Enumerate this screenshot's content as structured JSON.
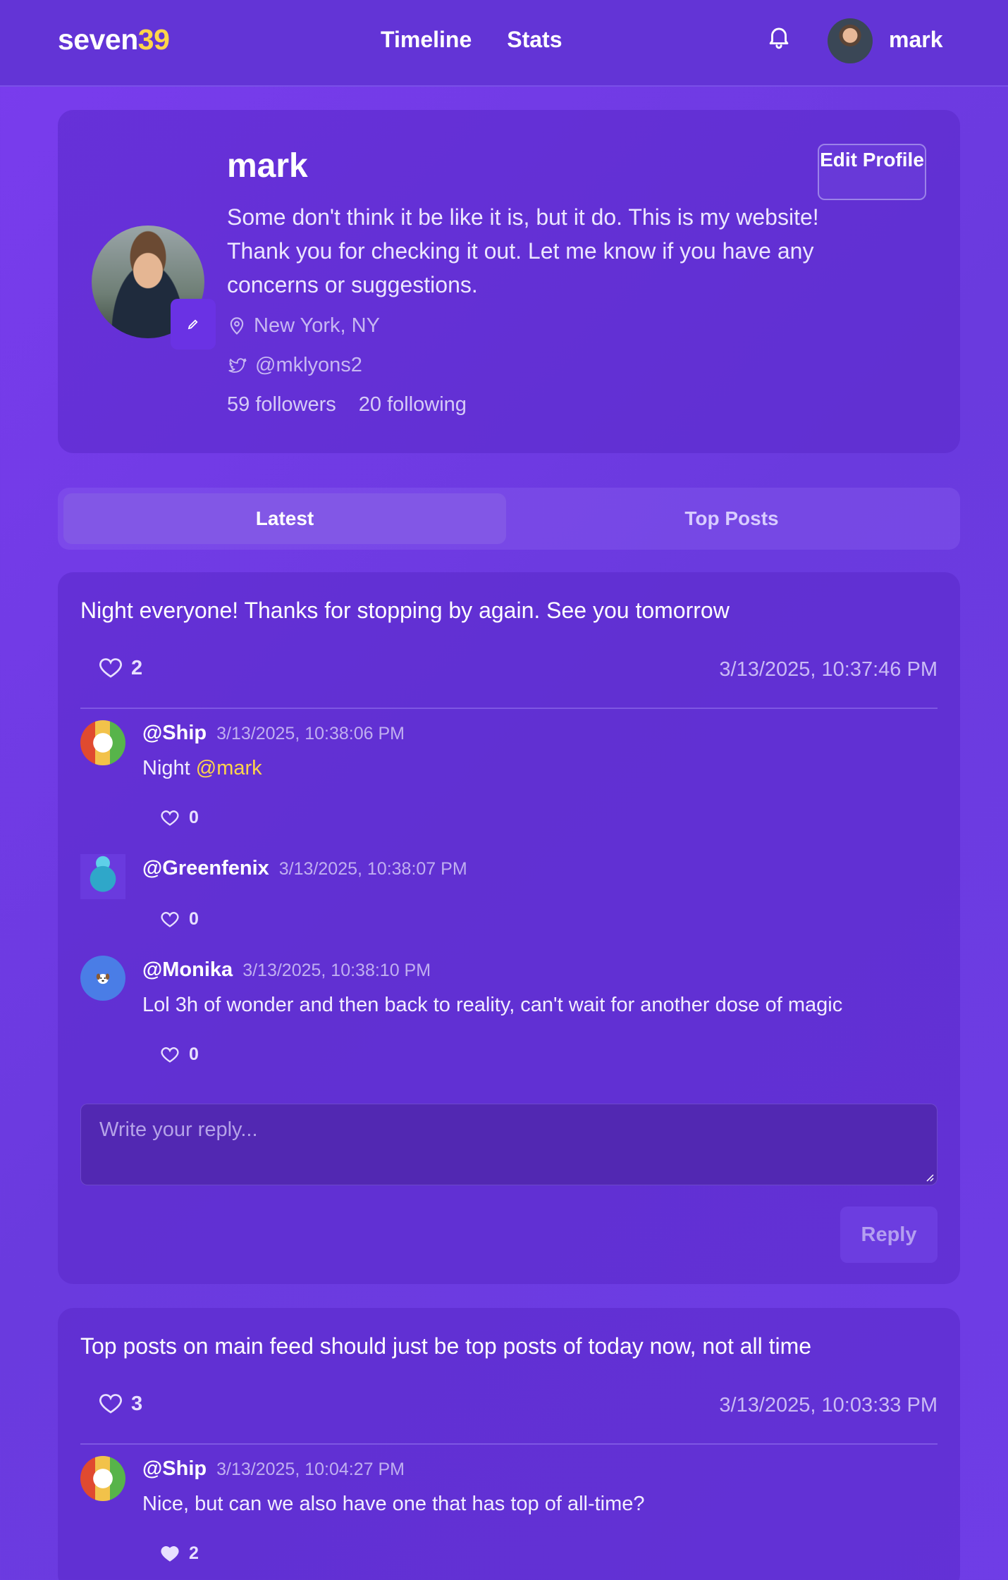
{
  "header": {
    "logo_main": "seven",
    "logo_accent": "39",
    "nav": [
      "Timeline",
      "Stats"
    ],
    "username": "mark"
  },
  "profile": {
    "name": "mark",
    "bio": "Some don't think it be like it is, but it do. This is my website! Thank you for checking it out. Let me know if you have any concerns or suggestions.",
    "location": "New York, NY",
    "twitter": "@mklyons2",
    "followers": "59 followers",
    "following": "20 following",
    "edit_button": "Edit Profile"
  },
  "tabs": {
    "active": "Latest",
    "inactive": "Top Posts"
  },
  "posts": [
    {
      "text": "Night everyone! Thanks for stopping by again. See you tomorrow",
      "likes": "2",
      "time": "3/13/2025, 10:37:46 PM",
      "comments": [
        {
          "author": "@Ship",
          "time": "3/13/2025, 10:38:06 PM",
          "text_prefix": "Night ",
          "mention": "@mark",
          "likes": "0"
        },
        {
          "author": "@Greenfenix",
          "time": "3/13/2025, 10:38:07 PM",
          "text_prefix": "",
          "mention": "",
          "likes": "0"
        },
        {
          "author": "@Monika",
          "time": "3/13/2025, 10:38:10 PM",
          "text_prefix": "Lol 3h of wonder and then back to reality, can't wait for another dose of magic",
          "mention": "",
          "likes": "0"
        }
      ],
      "reply_placeholder": "Write your reply...",
      "reply_button": "Reply"
    },
    {
      "text": "Top posts on main feed should just be top posts of today now, not all time",
      "likes": "3",
      "time": "3/13/2025, 10:03:33 PM",
      "comments": [
        {
          "author": "@Ship",
          "time": "3/13/2025, 10:04:27 PM",
          "text_prefix": "Nice, but can we also have one that has top of all-time?",
          "mention": "",
          "likes": "2"
        }
      ]
    }
  ],
  "colors": {
    "accent": "#ffd54a",
    "background": "#7a3cee",
    "card": "#5a28c8"
  }
}
